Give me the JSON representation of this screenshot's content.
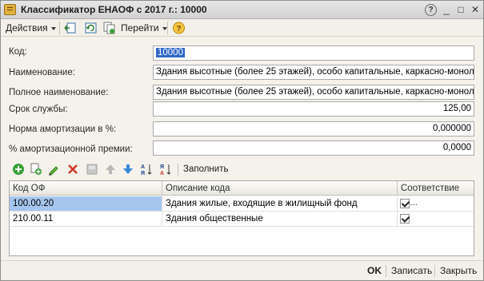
{
  "window": {
    "title": "Классификатор ЕНАОФ с 2017 г.: 10000",
    "controls": {
      "help": "?",
      "minimize": "_",
      "maximize": "□",
      "close": "✕"
    }
  },
  "toolbar": {
    "actions_label": "Действия",
    "goto_label": "Перейти",
    "icons": [
      "go-up-icon",
      "refresh-icon",
      "copy-icon",
      "help-icon"
    ]
  },
  "form": {
    "code": {
      "label": "Код:",
      "value": "10000"
    },
    "name": {
      "label": "Наименование:",
      "value": "Здания высотные (более 25 этажей), особо капитальные, каркасно-монолитн"
    },
    "full_name": {
      "label": "Полное наименование:",
      "value": "Здания высотные (более 25 этажей), особо капитальные, каркасно-монолитн"
    },
    "service_life": {
      "label": "Срок службы:",
      "value": "125,00"
    },
    "depreciation_rate": {
      "label": "Норма амортизации в %:",
      "value": "0,000000"
    },
    "bonus_percent": {
      "label": "% амортизационной премии:",
      "value": "0,0000"
    }
  },
  "table_toolbar": {
    "icons": [
      "add-icon",
      "copy-row-icon",
      "edit-icon",
      "delete-icon",
      "end-edit-icon",
      "move-up-icon",
      "move-down-icon",
      "sort-asc-icon",
      "sort-desc-icon"
    ],
    "fill_label": "Заполнить"
  },
  "table": {
    "columns": [
      "Код ОФ",
      "Описание кода",
      "Соответствие ус..."
    ],
    "rows": [
      {
        "code": "100.00.20",
        "description": "Здания жилые, входящие в жилищный фонд",
        "match": true
      },
      {
        "code": "210.00.11",
        "description": "Здания общественные",
        "match": true
      }
    ]
  },
  "bottom": {
    "ok_label": "OK",
    "save_label": "Записать",
    "close_label": "Закрыть"
  },
  "colors": {
    "selection": "#3169c6",
    "row_selection": "#a6c6ee",
    "window_bg": "#f4f2ea"
  }
}
